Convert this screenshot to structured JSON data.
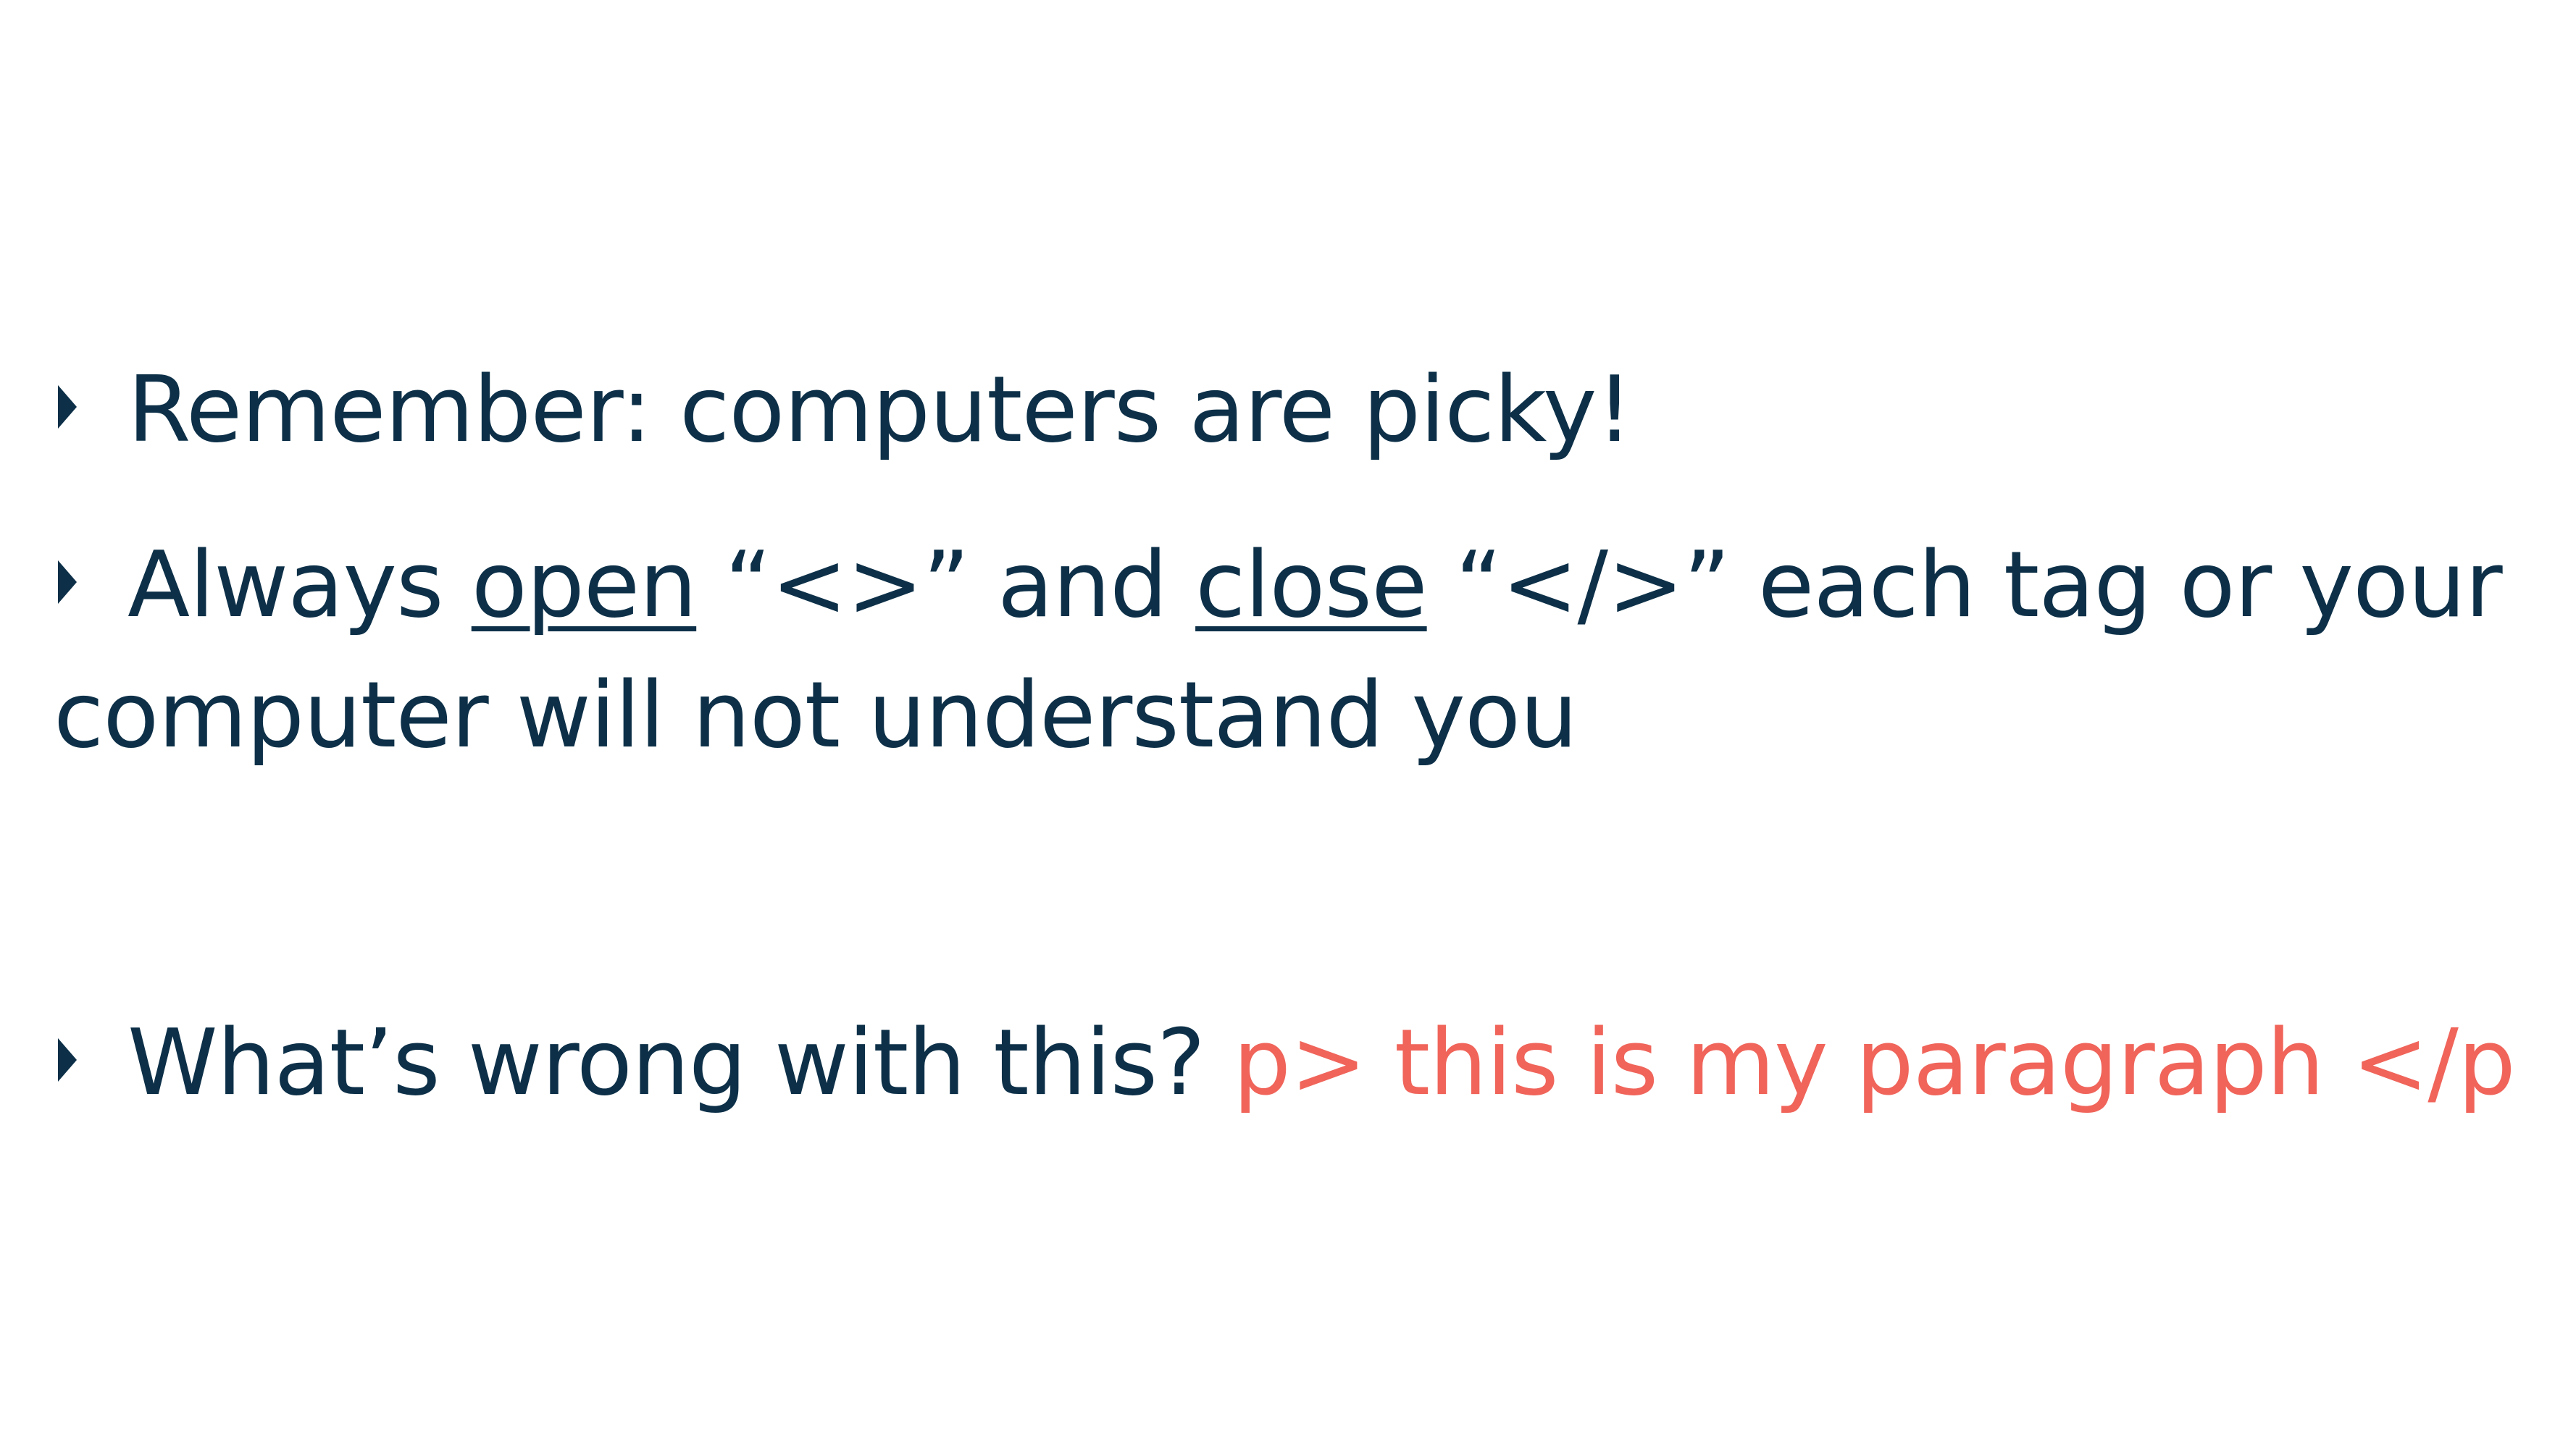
{
  "bullets": {
    "remember": {
      "text": "Remember: computers are picky!"
    },
    "always": {
      "prefix": "Always ",
      "open_word": "open",
      "middle1": " “<>” and ",
      "close_word": "close",
      "middle2": " “</>” each tag or your",
      "continuation": "computer will not understand you"
    },
    "question": {
      "prompt": "What’s wrong with this? ",
      "code_example": "p> this is my paragraph </p"
    }
  },
  "colors": {
    "text": "#0d3048",
    "code": "#f0645a",
    "background": "#ffffff"
  }
}
